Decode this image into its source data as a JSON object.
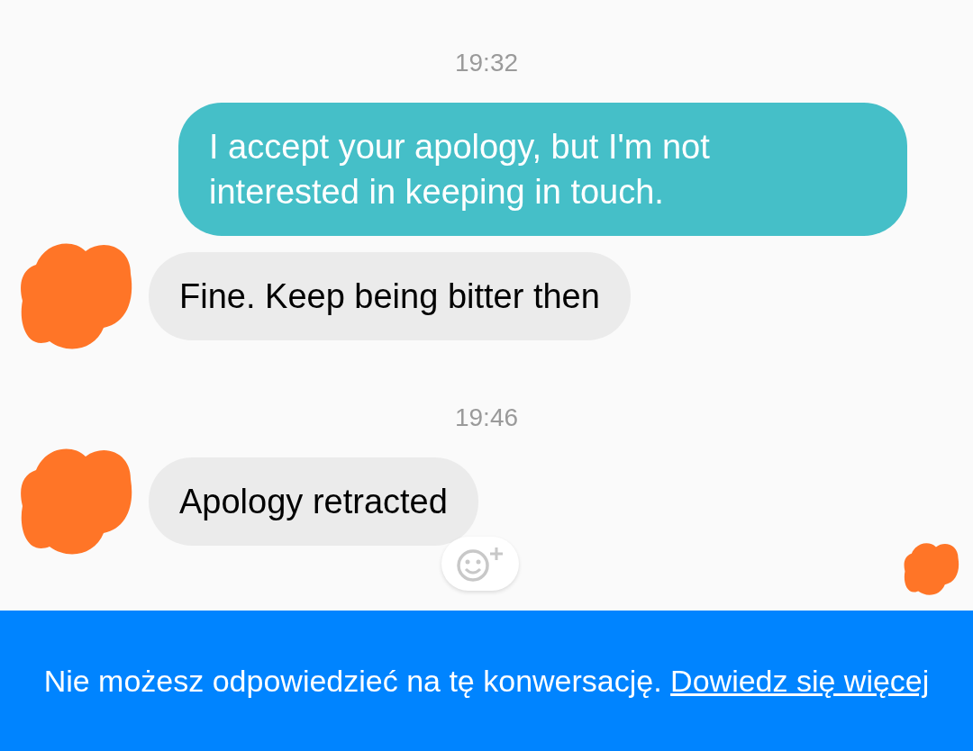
{
  "conversation": [
    {
      "kind": "time",
      "text": "19:32"
    },
    {
      "kind": "message",
      "outgoing": true,
      "text": "I accept your apology, but I'm not interested in keeping in touch.",
      "reaction_button": false
    },
    {
      "kind": "message",
      "outgoing": false,
      "text": "Fine. Keep being bitter then",
      "reaction_button": false
    },
    {
      "kind": "time",
      "text": "19:46"
    },
    {
      "kind": "message",
      "outgoing": false,
      "text": "Apology retracted",
      "reaction_button": true
    }
  ],
  "notice": {
    "text": "Nie możesz odpowiedzieć na tę konwersację.",
    "link": "Dowiedz się więcej"
  }
}
